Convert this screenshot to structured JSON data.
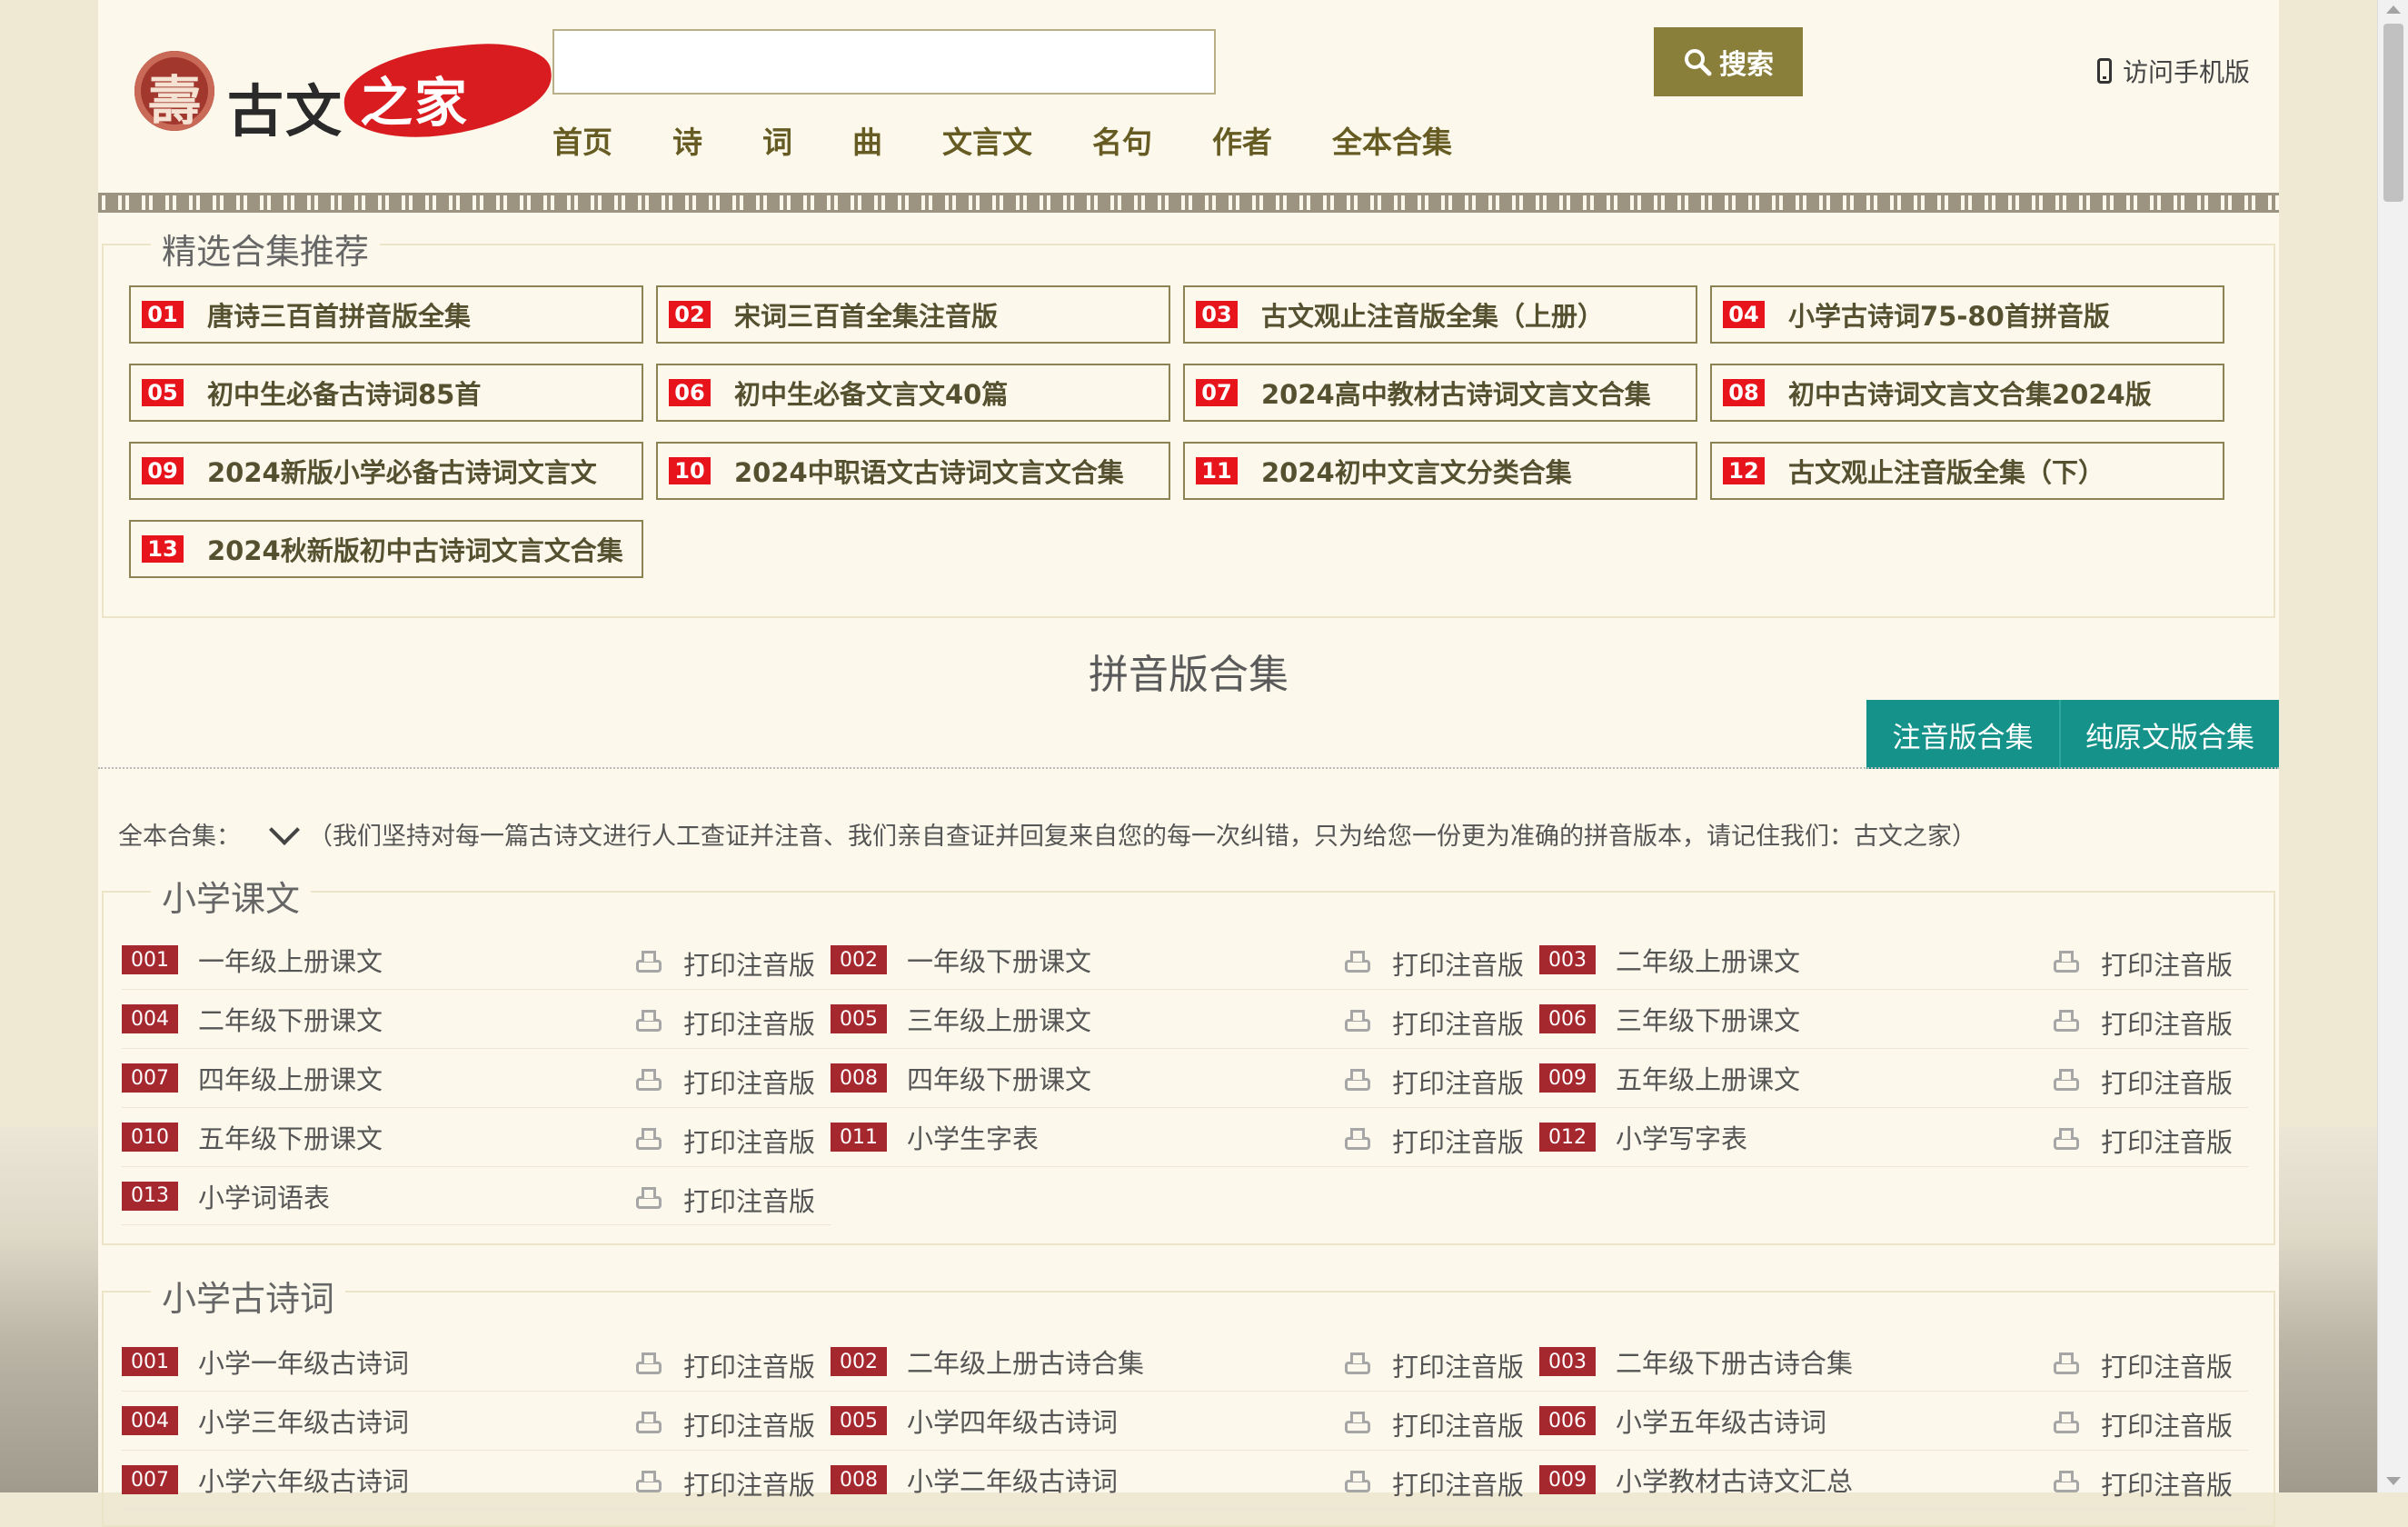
{
  "header": {
    "logo_text": "古文",
    "logo_red_text": "之家",
    "search_placeholder": "",
    "search_button": "搜索",
    "mobile_link": "访问手机版"
  },
  "nav": [
    "首页",
    "诗",
    "词",
    "曲",
    "文言文",
    "名句",
    "作者",
    "全本合集"
  ],
  "recommend": {
    "title": "精选合集推荐",
    "items": [
      {
        "num": "01",
        "title": "唐诗三百首拼音版全集"
      },
      {
        "num": "02",
        "title": "宋词三百首全集注音版"
      },
      {
        "num": "03",
        "title": "古文观止注音版全集（上册）"
      },
      {
        "num": "04",
        "title": "小学古诗词75-80首拼音版"
      },
      {
        "num": "05",
        "title": "初中生必备古诗词85首"
      },
      {
        "num": "06",
        "title": "初中生必备文言文40篇"
      },
      {
        "num": "07",
        "title": "2024高中教材古诗词文言文合集"
      },
      {
        "num": "08",
        "title": "初中古诗词文言文合集2024版"
      },
      {
        "num": "09",
        "title": "2024新版小学必备古诗词文言文"
      },
      {
        "num": "10",
        "title": "2024中职语文古诗词文言文合集"
      },
      {
        "num": "11",
        "title": "2024初中文言文分类合集"
      },
      {
        "num": "12",
        "title": "古文观止注音版全集（下）"
      },
      {
        "num": "13",
        "title": "2024秋新版初中古诗词文言文合集"
      }
    ]
  },
  "pinyin": {
    "title": "拼音版合集",
    "tabs": [
      "注音版合集",
      "纯原文版合集"
    ],
    "intro_label": "全本合集：",
    "intro_text": "（我们坚持对每一篇古诗文进行人工查证并注音、我们亲自查证并回复来自您的每一次纠错，只为给您一份更为准确的拼音版本，请记住我们：古文之家）",
    "print_label": "打印注音版"
  },
  "primary_texts": {
    "title": "小学课文",
    "items": [
      {
        "num": "001",
        "title": "一年级上册课文"
      },
      {
        "num": "002",
        "title": "一年级下册课文"
      },
      {
        "num": "003",
        "title": "二年级上册课文"
      },
      {
        "num": "004",
        "title": "二年级下册课文"
      },
      {
        "num": "005",
        "title": "三年级上册课文"
      },
      {
        "num": "006",
        "title": "三年级下册课文"
      },
      {
        "num": "007",
        "title": "四年级上册课文"
      },
      {
        "num": "008",
        "title": "四年级下册课文"
      },
      {
        "num": "009",
        "title": "五年级上册课文"
      },
      {
        "num": "010",
        "title": "五年级下册课文"
      },
      {
        "num": "011",
        "title": "小学生字表"
      },
      {
        "num": "012",
        "title": "小学写字表"
      },
      {
        "num": "013",
        "title": "小学词语表"
      }
    ]
  },
  "primary_poems": {
    "title": "小学古诗词",
    "items": [
      {
        "num": "001",
        "title": "小学一年级古诗词"
      },
      {
        "num": "002",
        "title": "二年级上册古诗合集"
      },
      {
        "num": "003",
        "title": "二年级下册古诗合集"
      },
      {
        "num": "004",
        "title": "小学三年级古诗词"
      },
      {
        "num": "005",
        "title": "小学四年级古诗词"
      },
      {
        "num": "006",
        "title": "小学五年级古诗词"
      },
      {
        "num": "007",
        "title": "小学六年级古诗词"
      },
      {
        "num": "008",
        "title": "小学二年级古诗词"
      },
      {
        "num": "009",
        "title": "小学教材古诗文汇总"
      }
    ]
  }
}
